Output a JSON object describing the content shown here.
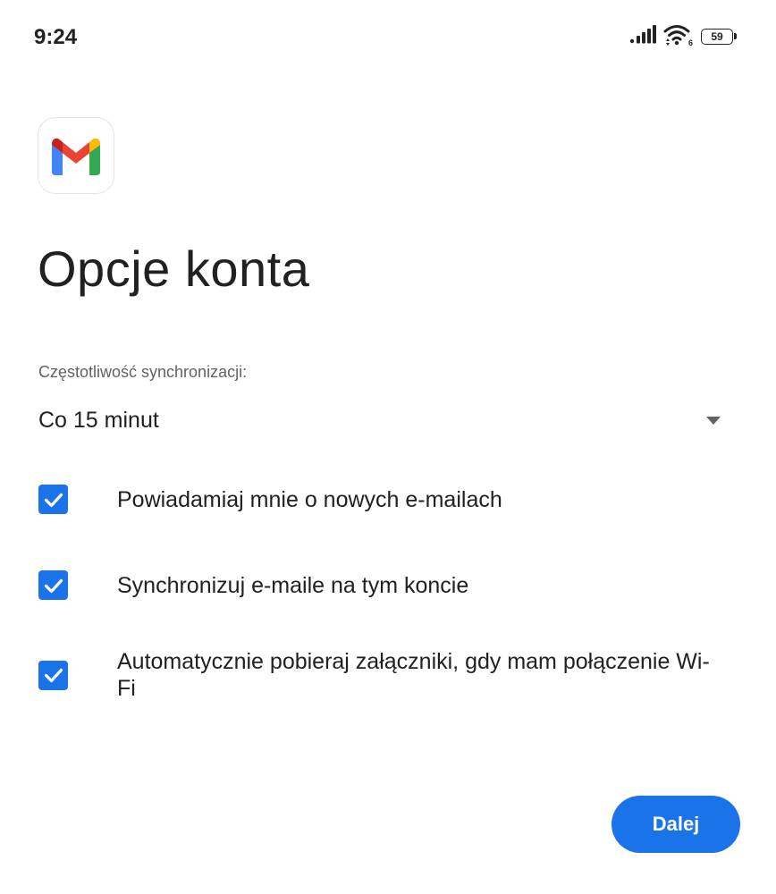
{
  "status_bar": {
    "time": "9:24",
    "battery_level": "59",
    "icons": [
      "signal-icon",
      "wifi-icon",
      "battery-icon"
    ]
  },
  "app": {
    "logo": "gmail-logo-icon"
  },
  "page": {
    "title": "Opcje konta"
  },
  "sync": {
    "label": "Częstotliwość synchronizacji:",
    "selected_value": "Co 15 minut"
  },
  "options": [
    {
      "label": "Powiadamiaj mnie o nowych e-mailach",
      "checked": true
    },
    {
      "label": "Synchronizuj e-maile na tym koncie",
      "checked": true
    },
    {
      "label": "Automatycznie pobieraj załączniki, gdy mam połączenie Wi-Fi",
      "checked": true
    }
  ],
  "actions": {
    "next_label": "Dalej"
  },
  "colors": {
    "accent": "#1a73e8",
    "text_primary": "#202124",
    "text_secondary": "#5f6368"
  }
}
